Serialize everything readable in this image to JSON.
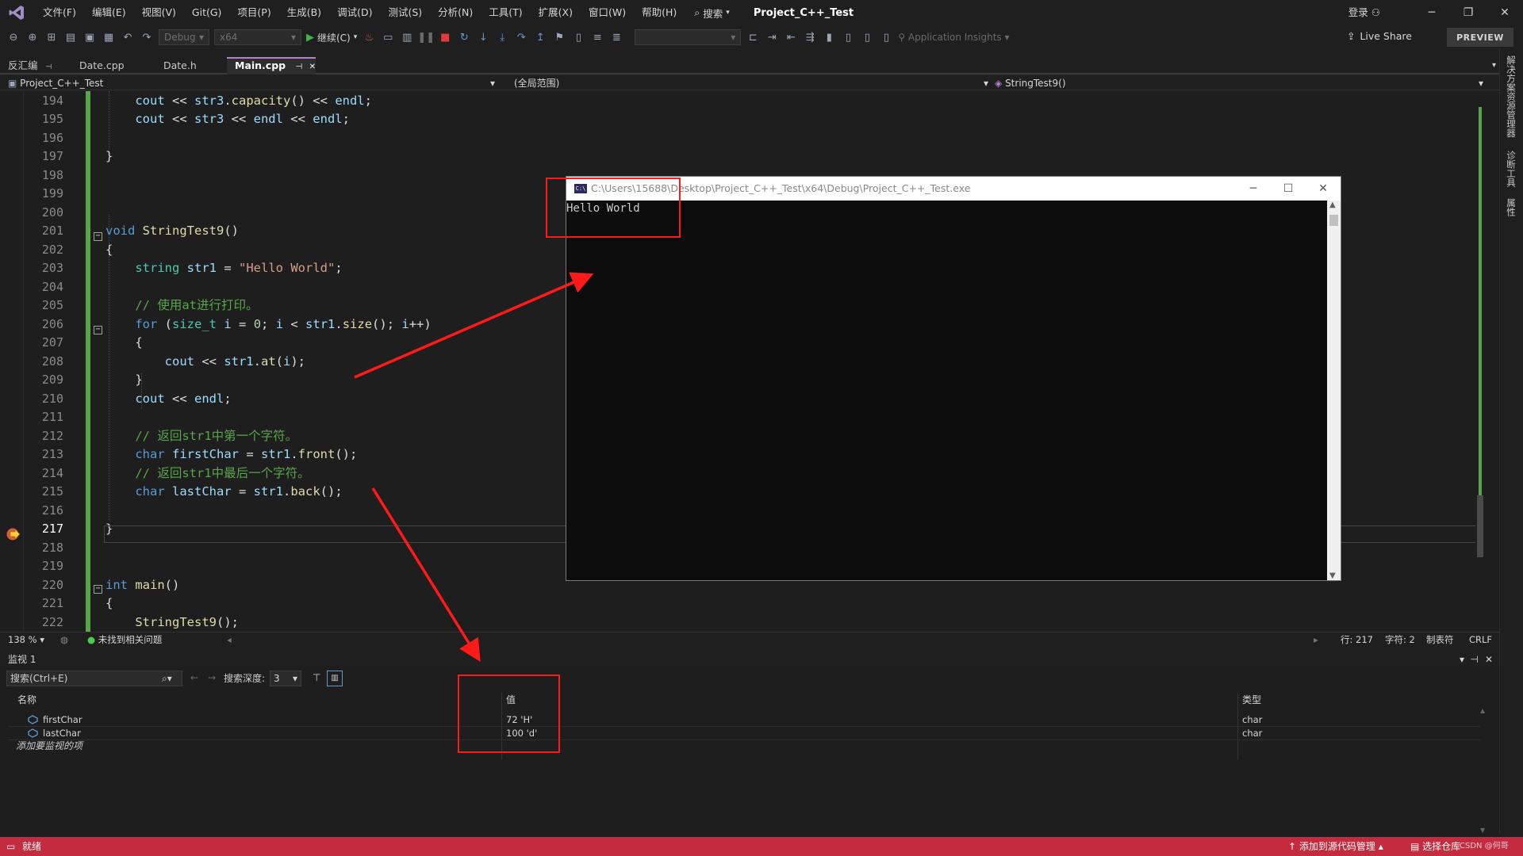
{
  "menubar": {
    "items": [
      "文件(F)",
      "编辑(E)",
      "视图(V)",
      "Git(G)",
      "项目(P)",
      "生成(B)",
      "调试(D)",
      "测试(S)",
      "分析(N)",
      "工具(T)",
      "扩展(X)",
      "窗口(W)",
      "帮助(H)"
    ],
    "search": "搜索",
    "solution": "Project_C++_Test",
    "login": "登录"
  },
  "toolbar": {
    "config": "Debug",
    "platform": "x64",
    "continue": "继续(C)",
    "app_insights": "Application Insights",
    "live_share": "Live Share",
    "preview": "PREVIEW"
  },
  "tabs": [
    {
      "label": "反汇编"
    },
    {
      "label": "Date.cpp"
    },
    {
      "label": "Date.h"
    },
    {
      "label": "Main.cpp"
    }
  ],
  "navbar": {
    "project": "Project_C++_Test",
    "scope": "(全局范围)",
    "function": "StringTest9()"
  },
  "editor": {
    "line_numbers": [
      "194",
      "195",
      "196",
      "197",
      "198",
      "199",
      "200",
      "201",
      "202",
      "203",
      "204",
      "205",
      "206",
      "207",
      "208",
      "209",
      "210",
      "211",
      "212",
      "213",
      "214",
      "215",
      "216",
      "217",
      "218",
      "219",
      "220",
      "221",
      "222"
    ],
    "current_line": "217"
  },
  "console": {
    "path": "C:\\Users\\15688\\Desktop\\Project_C++_Test\\x64\\Debug\\Project_C++_Test.exe",
    "output": "Hello World"
  },
  "editor_status": {
    "zoom": "138 %",
    "issues": "未找到相关问题",
    "line": "行: 217",
    "col": "字符: 2",
    "tab": "制表符",
    "eol": "CRLF"
  },
  "watch": {
    "title": "监视 1",
    "search_placeholder": "搜索(Ctrl+E)",
    "depth_label": "搜索深度:",
    "depth_value": "3",
    "columns": {
      "name": "名称",
      "value": "值",
      "type": "类型"
    },
    "rows": [
      {
        "name": "firstChar",
        "value": "72 'H'",
        "type": "char"
      },
      {
        "name": "lastChar",
        "value": "100 'd'",
        "type": "char"
      }
    ],
    "add_hint": "添加要监视的项"
  },
  "right_panel": [
    "解决方案资源管理器",
    "诊断工具",
    "属性"
  ],
  "statusbar": {
    "ready": "就绪",
    "source_control": "添加到源代码管理",
    "repo": "选择仓库",
    "watermark": "CSDN @何哥"
  },
  "colors": {
    "status_bar": "#c42b3f",
    "annotation_red": "#ff1a1a",
    "active_tab_accent": "#b180d7"
  }
}
